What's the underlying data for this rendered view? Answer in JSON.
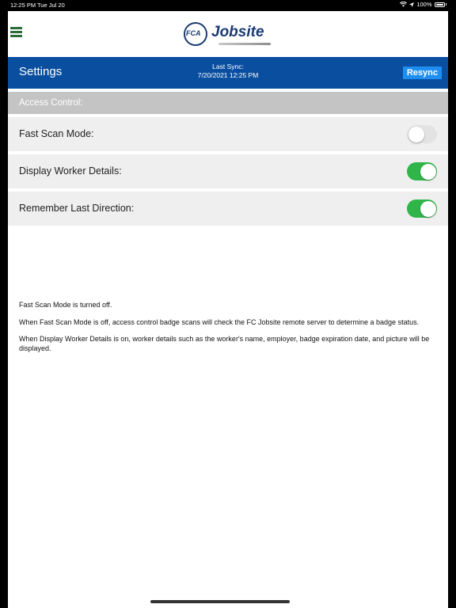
{
  "status_bar": {
    "time": "12:25 PM",
    "date": "Tue Jul 20",
    "battery": "100%",
    "icons": [
      "wifi-icon",
      "location-icon",
      "battery-icon"
    ]
  },
  "topbar": {
    "menu_icon": "hamburger-menu-icon",
    "logo": {
      "mark": "FCA",
      "word": "Jobsite"
    }
  },
  "header": {
    "title": "Settings",
    "sync_label": "Last Sync:",
    "sync_value": "7/20/2021 12:25 PM",
    "resync_label": "Resync"
  },
  "section": {
    "title": "Access Control:"
  },
  "settings": [
    {
      "label": "Fast Scan Mode:",
      "enabled": false
    },
    {
      "label": "Display Worker Details:",
      "enabled": true
    },
    {
      "label": "Remember Last Direction:",
      "enabled": true
    }
  ],
  "info": [
    "Fast Scan Mode is turned off.",
    "When Fast Scan Mode is off, access control badge scans will check the FC Jobsite remote server to determine a badge status.",
    "When Display Worker Details is on, worker details such as the worker's name, employer, badge expiration date, and picture will be displayed."
  ],
  "colors": {
    "header_blue": "#0a4f9f",
    "resync_blue": "#1e8ff0",
    "toggle_on": "#2fb54a",
    "menu_green": "#2e6b3a",
    "logo_navy": "#1c3b72"
  }
}
